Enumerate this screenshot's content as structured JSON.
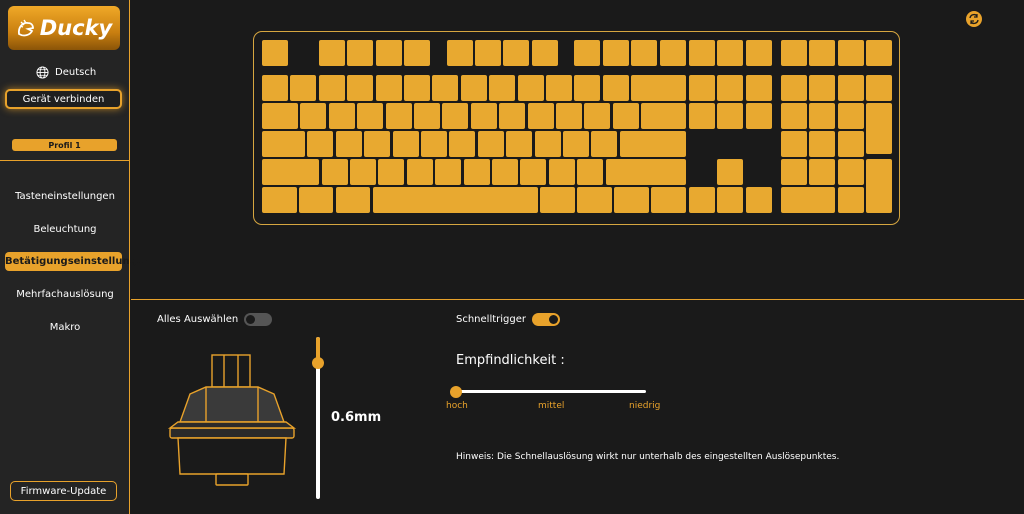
{
  "sidebar": {
    "logo": "Ducky",
    "language": "Deutsch",
    "connect_label": "Gerät verbinden",
    "profile_label": "Profil 1",
    "menu": [
      {
        "label": "Tasteneinstellungen",
        "active": false
      },
      {
        "label": "Beleuchtung",
        "active": false
      },
      {
        "label": "Betätigungseinstellungen",
        "active": true
      },
      {
        "label": "Mehrfachauslösung",
        "active": false
      },
      {
        "label": "Makro",
        "active": false
      }
    ],
    "firmware_label": "Firmware-Update"
  },
  "settings": {
    "select_all_label": "Alles Auswählen",
    "select_all_on": false,
    "rapid_trigger_label": "Schnelltrigger",
    "rapid_trigger_on": true,
    "actuation_depth": "0.6mm",
    "sensitivity_title": "Empfindlichkeit :",
    "sensitivity_labels": [
      "hoch",
      "mittel",
      "niedrig"
    ],
    "sensitivity_value": "hoch",
    "note": "Hinweis: Die Schnellauslösung wirkt nur unterhalb des eingestellten Auslösepunktes."
  },
  "colors": {
    "accent": "#e8a22b",
    "key": "#e8a930",
    "background": "#1a1a1a",
    "sidebar": "#242424"
  },
  "icons": [
    "globe-icon",
    "refresh-icon",
    "switch-icon"
  ]
}
